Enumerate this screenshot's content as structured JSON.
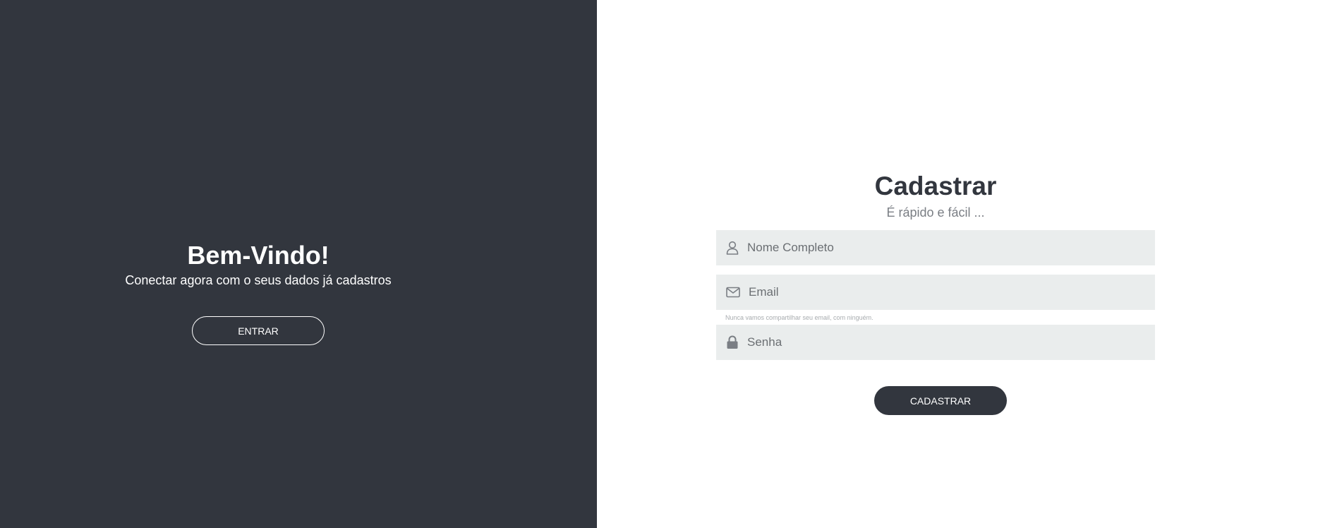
{
  "welcome": {
    "title": "Bem-Vindo!",
    "subtitle": "Conectar agora com o seus dados já cadastros",
    "enter_label": "ENTRAR"
  },
  "signup": {
    "title": "Cadastrar",
    "subtitle": "É rápido e fácil ...",
    "name_placeholder": "Nome Completo",
    "email_placeholder": "Email",
    "email_help": "Nunca vamos compartilhar seu email, com ninguém.",
    "password_placeholder": "Senha",
    "submit_label": "CADASTRAR"
  },
  "icons": {
    "name": "user-icon",
    "email": "envelope-icon",
    "password": "lock-icon"
  },
  "colors": {
    "dark": "#32363e",
    "field_bg": "#eaeded",
    "text_muted": "#7a7e84"
  }
}
